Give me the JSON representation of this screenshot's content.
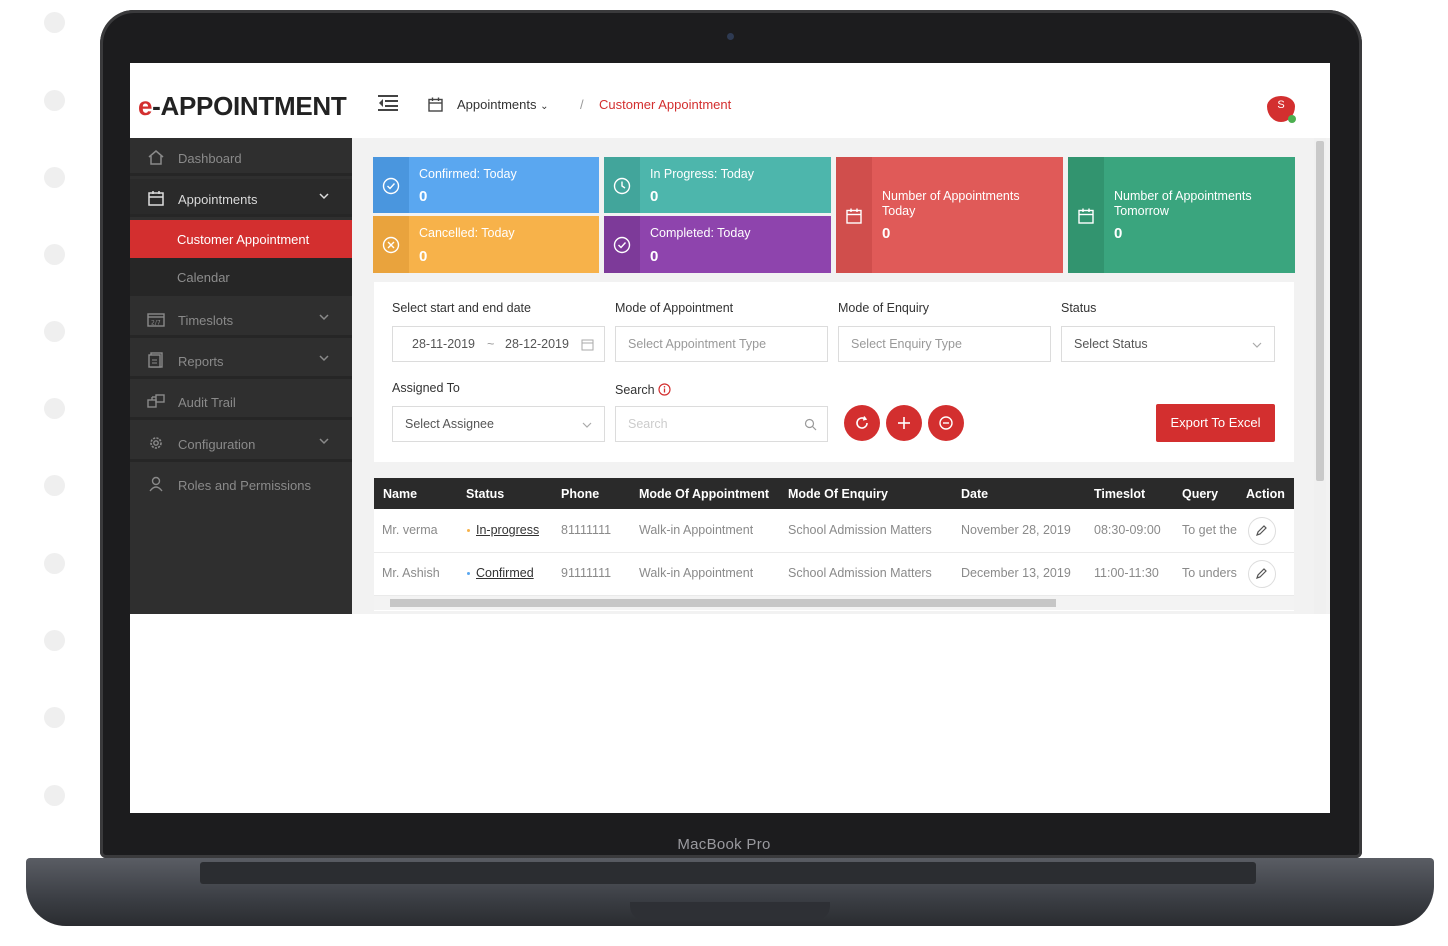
{
  "device": {
    "label": "MacBook Pro"
  },
  "header": {
    "logo_prefix": "e",
    "logo_rest": "-APPOINTMENT",
    "breadcrumb_parent": "Appointments",
    "breadcrumb_sep": "/",
    "breadcrumb_current": "Customer Appointment",
    "avatar_initial": "S"
  },
  "sidebar": {
    "items": [
      {
        "label": "Dashboard",
        "icon": "home-icon"
      },
      {
        "label": "Appointments",
        "icon": "calendar-icon"
      },
      {
        "label": "Customer Appointment"
      },
      {
        "label": "Calendar"
      },
      {
        "label": "Timeslots",
        "icon": "timeslot-icon"
      },
      {
        "label": "Reports",
        "icon": "report-icon"
      },
      {
        "label": "Audit Trail",
        "icon": "audit-icon"
      },
      {
        "label": "Configuration",
        "icon": "gear-icon"
      },
      {
        "label": "Roles and Permissions",
        "icon": "user-icon"
      }
    ]
  },
  "cards": {
    "confirmed": {
      "title": "Confirmed: Today",
      "value": "0",
      "color": "#5aa7f0"
    },
    "in_progress": {
      "title": "In Progress: Today",
      "value": "0",
      "color": "#4db6ac"
    },
    "cancelled": {
      "title": "Cancelled: Today",
      "value": "0",
      "color": "#f7b24a"
    },
    "completed": {
      "title": "Completed: Today",
      "value": "0",
      "color": "#8e44ad"
    },
    "today": {
      "title_line1": "Number of Appointments",
      "title_line2": "Today",
      "value": "0",
      "color": "#e05a58"
    },
    "tomorrow": {
      "title_line1": "Number of Appointments",
      "title_line2": "Tomorrow",
      "value": "0",
      "color": "#3aa57e"
    }
  },
  "filters": {
    "date_label": "Select start and end date",
    "date_start": "28-11-2019",
    "date_sep": "~",
    "date_end": "28-12-2019",
    "mode_label": "Mode of Appointment",
    "mode_placeholder": "Select Appointment Type",
    "enquiry_label": "Mode of Enquiry",
    "enquiry_placeholder": "Select Enquiry Type",
    "status_label": "Status",
    "status_placeholder": "Select Status",
    "assigned_label": "Assigned To",
    "assigned_placeholder": "Select Assignee",
    "search_label": "Search",
    "search_placeholder": "Search",
    "export_label": "Export To Excel"
  },
  "table": {
    "headers": [
      "Name",
      "Status",
      "Phone",
      "Mode Of Appointment",
      "Mode Of Enquiry",
      "Date",
      "Timeslot",
      "Query",
      "Action"
    ],
    "rows": [
      {
        "name": "Mr. verma",
        "status": "In-progress",
        "status_color": "#f7b24a",
        "phone": "81111111",
        "mode": "Walk-in Appointment",
        "enquiry": "School Admission Matters",
        "date": "November 28, 2019",
        "timeslot": "08:30-09:00",
        "query": "To get the"
      },
      {
        "name": "Mr. Ashish",
        "status": "Confirmed",
        "status_color": "#5aa7f0",
        "phone": "91111111",
        "mode": "Walk-in Appointment",
        "enquiry": "School Admission Matters",
        "date": "December 13, 2019",
        "timeslot": "11:00-11:30",
        "query": "To unders"
      }
    ]
  }
}
